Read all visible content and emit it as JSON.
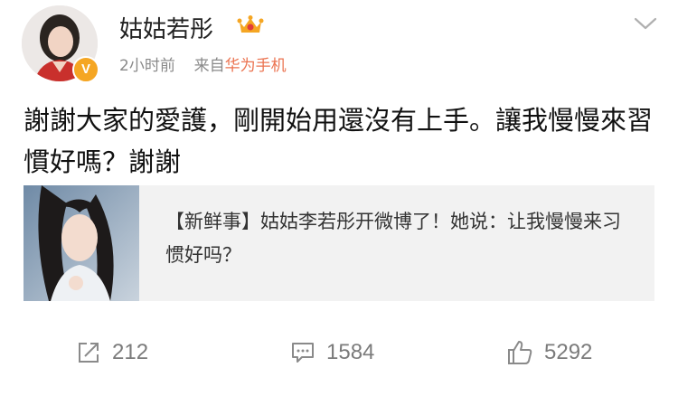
{
  "user": {
    "name": "姑姑若彤",
    "verified_badge": "V",
    "time": "2小时前",
    "source_prefix": "来自",
    "source": "华为手机"
  },
  "post": {
    "text": "謝謝大家的愛護，剛開始用還沒有上手。讓我慢慢來習慣好嗎？謝謝"
  },
  "card": {
    "text": "【新鲜事】姑姑李若彤开微博了！她说：让我慢慢来习惯好吗？"
  },
  "actions": {
    "repost_count": "212",
    "comment_count": "1584",
    "like_count": "5292"
  },
  "colors": {
    "accent": "#eb7350",
    "badge": "#f5a623",
    "muted": "#8a8a8a",
    "card_bg": "#f2f2f2"
  },
  "icons": [
    "crown-icon",
    "chevron-down-icon",
    "repost-icon",
    "comment-icon",
    "like-icon"
  ]
}
